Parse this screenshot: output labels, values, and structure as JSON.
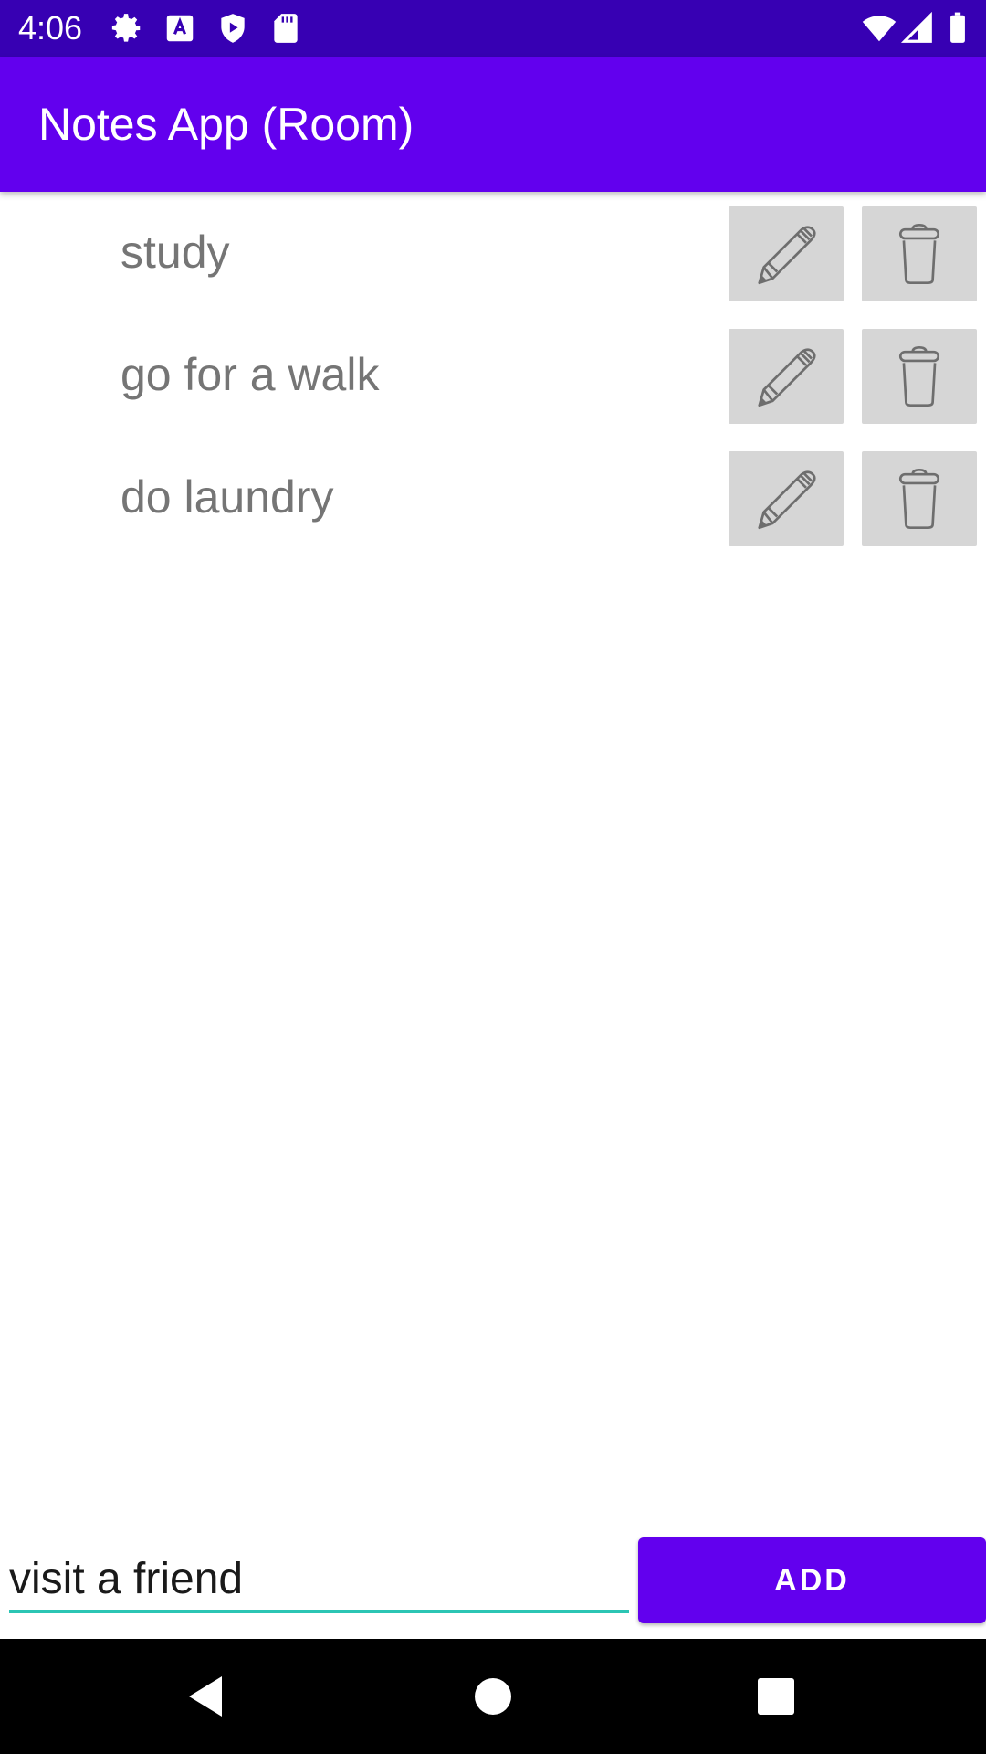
{
  "status_bar": {
    "time": "4:06",
    "left_icons": [
      "settings-icon",
      "text-a-icon",
      "shield-play-icon",
      "sd-card-icon"
    ],
    "right_icons": [
      "wifi-icon",
      "signal-icon",
      "battery-icon"
    ]
  },
  "app_bar": {
    "title": "Notes App (Room)",
    "color": "#6200EE"
  },
  "notes": [
    {
      "text": "study"
    },
    {
      "text": "go for a walk"
    },
    {
      "text": "do laundry"
    }
  ],
  "note_actions": {
    "edit_icon": "pencil-icon",
    "delete_icon": "trash-icon"
  },
  "composer": {
    "input_value": "visit a friend",
    "add_label": "ADD",
    "underline_color": "#2BC5B4"
  },
  "nav_bar": {
    "buttons": [
      "back-icon",
      "home-icon",
      "recents-icon"
    ]
  }
}
